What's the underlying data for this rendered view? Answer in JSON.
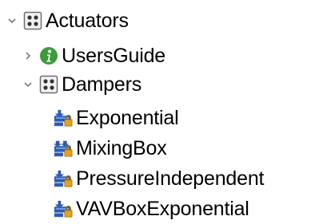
{
  "tree": {
    "actuators": {
      "label": "Actuators",
      "icon": "package-icon",
      "expanded": true
    },
    "users_guide": {
      "label": "UsersGuide",
      "icon": "info-icon",
      "expanded": false,
      "icon_color": "#3c9b3c"
    },
    "dampers": {
      "label": "Dampers",
      "icon": "package-icon",
      "expanded": true
    },
    "leaves": [
      {
        "label": "Exponential",
        "icon": "model-icon"
      },
      {
        "label": "MixingBox",
        "icon": "model-icon"
      },
      {
        "label": "PressureIndependent",
        "icon": "model-icon"
      },
      {
        "label": "VAVBoxExponential",
        "icon": "model-icon"
      }
    ]
  },
  "colors": {
    "chevron": "#7a7a7a",
    "package_border": "#6e6e6e",
    "package_fill": "#f2f2f2",
    "package_dots": "#333333",
    "model_blue": "#2a5bb5",
    "model_lock": "#e0a21c"
  }
}
